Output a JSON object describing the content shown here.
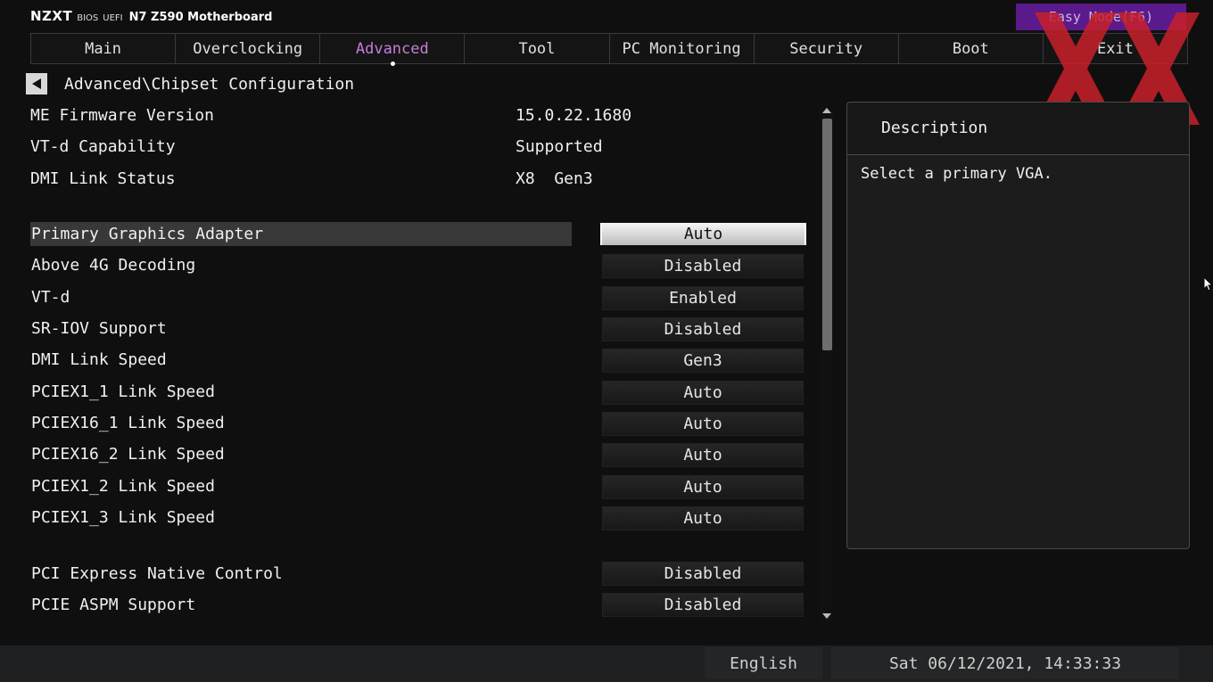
{
  "header": {
    "brand_logo": "NZXT",
    "bios_label": "BIOS",
    "uefi_label": "UEFI",
    "model": "N7 Z590 Motherboard",
    "easy_mode": "Easy Mode(F6)"
  },
  "tabs": [
    {
      "label": "Main",
      "active": false
    },
    {
      "label": "Overclocking",
      "active": false
    },
    {
      "label": "Advanced",
      "active": true
    },
    {
      "label": "Tool",
      "active": false
    },
    {
      "label": "PC Monitoring",
      "active": false
    },
    {
      "label": "Security",
      "active": false
    },
    {
      "label": "Boot",
      "active": false
    },
    {
      "label": "Exit",
      "active": false
    }
  ],
  "breadcrumb": "Advanced\\Chipset Configuration",
  "info": [
    {
      "label": "ME Firmware Version",
      "value": "15.0.22.1680"
    },
    {
      "label": "VT-d Capability",
      "value": "Supported"
    },
    {
      "label": "DMI Link Status",
      "value": "X8  Gen3"
    }
  ],
  "settings": [
    {
      "label": "Primary Graphics Adapter",
      "value": "Auto",
      "selected": true
    },
    {
      "label": "Above 4G Decoding",
      "value": "Disabled"
    },
    {
      "label": "VT-d",
      "value": "Enabled"
    },
    {
      "label": "SR-IOV Support",
      "value": "Disabled"
    },
    {
      "label": "DMI Link Speed",
      "value": "Gen3"
    },
    {
      "label": "PCIEX1_1 Link Speed",
      "value": "Auto"
    },
    {
      "label": "PCIEX16_1 Link Speed",
      "value": "Auto"
    },
    {
      "label": "PCIEX16_2 Link Speed",
      "value": "Auto"
    },
    {
      "label": "PCIEX1_2 Link Speed",
      "value": "Auto"
    },
    {
      "label": "PCIEX1_3 Link Speed",
      "value": "Auto"
    },
    {
      "label": "PCI Express Native Control",
      "value": "Disabled"
    },
    {
      "label": "PCIE ASPM Support",
      "value": "Disabled"
    }
  ],
  "description": {
    "title": "Description",
    "text": "Select a primary VGA."
  },
  "footer": {
    "language": "English",
    "datetime": "Sat 06/12/2021, 14:33:33"
  },
  "colors": {
    "active_tab": "#c77dd8",
    "easy_mode_bg": "#5a1a8c",
    "watermark": "#c8202a"
  },
  "icons": {
    "back": "triangle-left-icon",
    "scroll_up": "triangle-up-icon",
    "scroll_down": "triangle-down-icon",
    "cursor": "mouse-pointer-icon",
    "watermark": "hardwareluxx-xx-logo"
  }
}
